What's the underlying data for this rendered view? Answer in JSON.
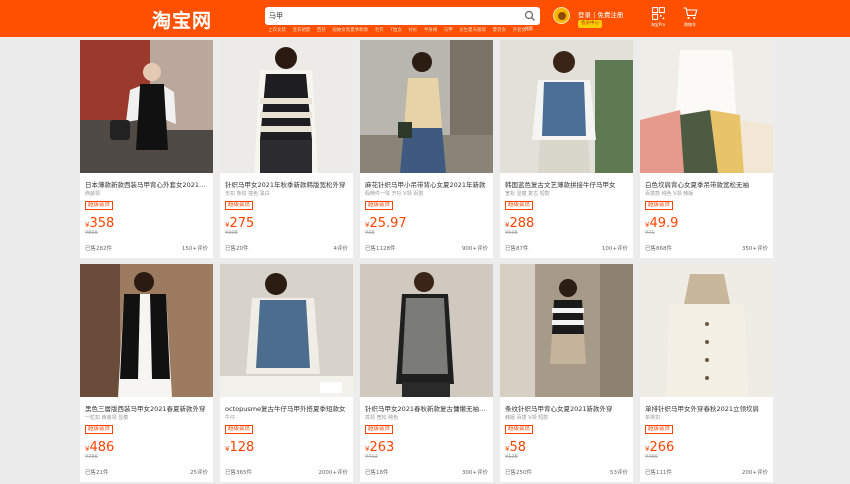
{
  "header": {
    "logo": "淘宝网",
    "search_value": "马甲",
    "search_label": "搜索",
    "hot_words": [
      "上衣女装",
      "连衣裙夏",
      "西装",
      "短袖女装夏季新款",
      "毛衣",
      "T恤女",
      "衬衫",
      "半身裙",
      "马甲",
      "女生夏天服装",
      "夏装女",
      "外套女"
    ],
    "login": "登录 | 免费注册",
    "member": "会员中心",
    "qr_label": "淘宝Pro",
    "cart_label": "购物车"
  },
  "products": [
    {
      "title": "日本薄款新款西装马甲背心外套女2021夏季新款",
      "tags": "西装领",
      "badge": "超级会员",
      "currency": "¥",
      "price": "358",
      "orig": "¥898",
      "sold": "已售282件",
      "reviews": "150+评价"
    },
    {
      "title": "针织马甲女2021年秋季新款韩版宽松外穿",
      "tags": "无扣 条纹 撞色 黑白",
      "badge": "超级会员",
      "currency": "¥",
      "price": "275",
      "orig": "¥398",
      "sold": "已售20件",
      "reviews": "4评价"
    },
    {
      "title": "麻花针织马甲小吊带背心女夏2021年新款",
      "tags": "假两件一体 开衫 V领 百搭",
      "badge": "超级会员",
      "currency": "¥",
      "price": "25.97",
      "orig": "¥38",
      "sold": "已售1128件",
      "reviews": "900+评价"
    },
    {
      "title": "韩国蓝色复古文艺薄款拼接牛仔马甲女",
      "tags": "宽松 显瘦 复古 短款",
      "badge": "超级会员",
      "currency": "¥",
      "price": "288",
      "orig": "¥598",
      "sold": "已售87件",
      "reviews": "100+评价"
    },
    {
      "title": "白色坎肩背心女夏季吊带款宽松无袖",
      "tags": "百搭款 纯色 V领 韩版",
      "badge": "超级会员",
      "currency": "¥",
      "price": "49.9",
      "orig": "¥71",
      "sold": "已售868件",
      "reviews": "350+评价"
    },
    {
      "title": "黑色三層版西装马甲女2021春夏新款外穿",
      "tags": "一粒扣 西装领 显瘦",
      "badge": "超级会员",
      "currency": "¥",
      "price": "486",
      "orig": "¥786",
      "sold": "已售21件",
      "reviews": "25评价"
    },
    {
      "title": "octopusme复古牛仔马甲外搭夏季短款女",
      "tags": "牛仔",
      "badge": "超级会员",
      "currency": "¥",
      "price": "128",
      "orig": "",
      "sold": "已售365件",
      "reviews": "2000+评价"
    },
    {
      "title": "针织马甲女2021春秋新款复古慵懒无袖毛衣",
      "tags": "高领 宽松 纯色",
      "badge": "超级会员",
      "currency": "¥",
      "price": "263",
      "orig": "¥412",
      "sold": "已售18件",
      "reviews": "300+评价"
    },
    {
      "title": "条纹针织马甲背心女夏2021新款外穿",
      "tags": "韩版 百搭 V领 短款",
      "badge": "超级会员",
      "currency": "¥",
      "price": "58",
      "orig": "¥128",
      "sold": "已售250件",
      "reviews": "53评价"
    },
    {
      "title": "单排针织马甲女外穿春秋2021立领坎肩",
      "tags": "单排扣",
      "badge": "超级会员",
      "currency": "¥",
      "price": "266",
      "orig": "¥486",
      "sold": "已售111件",
      "reviews": "200+评价"
    }
  ],
  "colors": {
    "brand": "#ff5000",
    "price": "#ff4400"
  },
  "icons": [
    "search-icon",
    "user-avatar-icon",
    "qr-code-icon",
    "cart-icon"
  ]
}
